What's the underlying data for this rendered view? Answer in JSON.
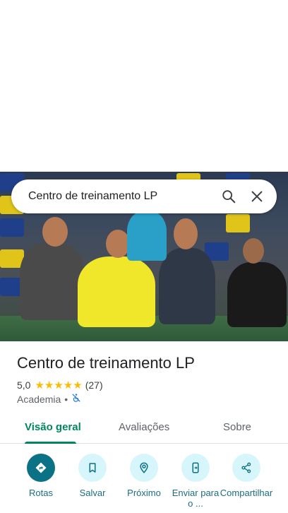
{
  "search": {
    "query": "Centro de treinamento LP",
    "search_icon": "search-icon",
    "close_icon": "close-icon"
  },
  "place": {
    "name": "Centro de treinamento LP",
    "rating": "5,0",
    "stars": "★★★★★",
    "review_count": "(27)",
    "category": "Academia",
    "separator": "•",
    "accessibility_icon": "no-wheelchair-icon"
  },
  "tabs": [
    {
      "label": "Visão geral",
      "active": true
    },
    {
      "label": "Avaliações",
      "active": false
    },
    {
      "label": "Sobre",
      "active": false
    }
  ],
  "actions": [
    {
      "label": "Rotas",
      "icon": "directions-icon"
    },
    {
      "label": "Salvar",
      "icon": "bookmark-icon"
    },
    {
      "label": "Próximo",
      "icon": "nearby-icon"
    },
    {
      "label": "Enviar para o ...",
      "icon": "send-to-phone-icon"
    },
    {
      "label": "Compartilhar",
      "icon": "share-icon"
    }
  ],
  "colors": {
    "accent": "#01875f",
    "action_circle": "#d7f6fc",
    "action_primary": "#0b7285",
    "star": "#fbbc04"
  }
}
